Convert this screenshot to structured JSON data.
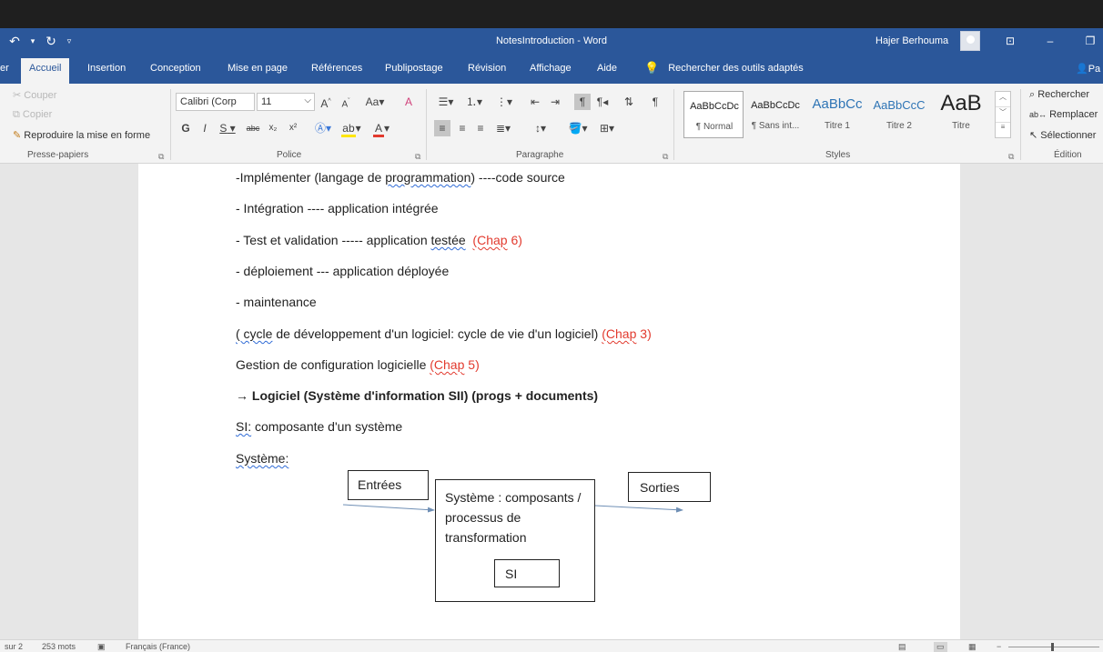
{
  "titlebar": {
    "title": "NotesIntroduction - Word",
    "user": "Hajer Berhouma",
    "undo_icon": "undo-icon",
    "redo_icon": "redo-icon",
    "qat_more_icon": "chevron-down-icon",
    "window_buttons": [
      "ribbon-display-icon",
      "minimize-icon",
      "restore-icon"
    ]
  },
  "tabs": {
    "items": [
      "er",
      "Accueil",
      "Insertion",
      "Conception",
      "Mise en page",
      "Références",
      "Publipostage",
      "Révision",
      "Affichage",
      "Aide"
    ],
    "active": "Accueil",
    "tell_me": "Rechercher des outils adaptés",
    "share": "Pa"
  },
  "ribbon": {
    "clipboard": {
      "cut": "Couper",
      "copy": "Copier",
      "format_painter": "Reproduire la mise en forme",
      "label": "Presse-papiers"
    },
    "font": {
      "font_name": "Calibri (Corp",
      "font_size": "11",
      "grow": "A",
      "shrink": "A",
      "case": "Aa",
      "clear": "A",
      "bold": "G",
      "italic": "I",
      "underline": "S",
      "strike": "abc",
      "subscript": "x₂",
      "superscript": "x²",
      "label": "Police"
    },
    "paragraph": {
      "label": "Paragraphe"
    },
    "styles": {
      "items": [
        {
          "sample": "AaBbCcDc",
          "name": "¶ Normal"
        },
        {
          "sample": "AaBbCcDc",
          "name": "¶ Sans int..."
        },
        {
          "sample": "AaBbCc",
          "name": "Titre 1"
        },
        {
          "sample": "AaBbCcC",
          "name": "Titre 2"
        },
        {
          "sample": "AaB",
          "name": "Titre"
        }
      ],
      "label": "Styles"
    },
    "editing": {
      "find": "Rechercher",
      "replace": "Remplacer",
      "select": "Sélectionner",
      "label": "Édition"
    },
    "accent_color": "#2b579a"
  },
  "document": {
    "lines": {
      "l1": {
        "a": "-Implémenter (langage de ",
        "b": "programmation",
        "c": ")  ----code source"
      },
      "l2": "- Intégration   ---- application intégrée",
      "l3": {
        "a": "- Test et validation ----- application ",
        "b": "testée",
        "c": "  ",
        "d": "(Chap",
        "e": " 6)"
      },
      "l4": "- déploiement --- application déployée",
      "l5": "- maintenance",
      "l6": {
        "a": "( cycle",
        "b": " de développement d'un logiciel: cycle de vie d'un logiciel) ",
        "c": "(Chap",
        "d": " 3)"
      },
      "l7": {
        "a": "Gestion de configuration logicielle ",
        "b": "(Chap",
        "c": " 5)"
      },
      "l8": {
        "arrow": "→",
        "text": " Logiciel (Système d'information SII) (progs + documents)"
      },
      "l9": {
        "a": "SI:",
        "b": " composante d'un système"
      },
      "l10": "Système:"
    },
    "diagram": {
      "inputs": "Entrées",
      "system": "Système : composants / processus de transformation",
      "si": "SI",
      "outputs": "Sorties"
    },
    "red_color": "#e23a2e"
  },
  "statusbar": {
    "page": "sur 2",
    "words": "253 mots",
    "language": "Français (France)",
    "zoom_minus": "−"
  }
}
